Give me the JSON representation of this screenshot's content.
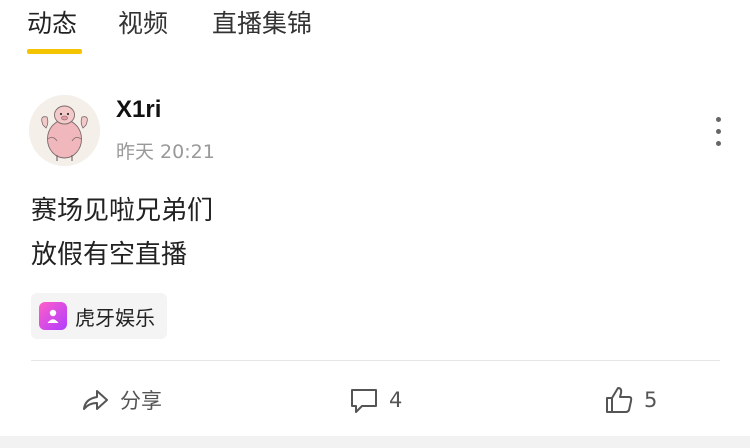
{
  "tabs": [
    {
      "label": "动态",
      "active": true
    },
    {
      "label": "视频",
      "active": false
    },
    {
      "label": "直播集锦",
      "active": false
    }
  ],
  "colors": {
    "accent": "#f5c400",
    "tag_icon": "#d84bff"
  },
  "post": {
    "username": "X1ri",
    "timestamp": "昨天 20:21",
    "content_lines": [
      "赛场见啦兄弟们",
      "放假有空直播"
    ],
    "tag": {
      "icon": "huya-app-icon",
      "label": "虎牙娱乐"
    },
    "actions": {
      "share_label": "分享",
      "comment_count": "4",
      "like_count": "5"
    }
  }
}
